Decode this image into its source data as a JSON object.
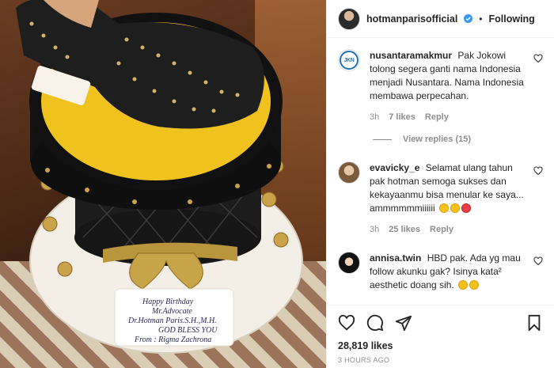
{
  "post": {
    "photo": {
      "cake_card_lines": [
        "Happy Birthday",
        "Mr.Advocate",
        "Dr.Hotman Paris.S.H.,M.H.",
        "GOD BLESS YOU",
        "From : Rigma Zachrona"
      ]
    },
    "header": {
      "username": "hotmanparisofficial",
      "separator": "•",
      "follow_label": "Following"
    },
    "comments": [
      {
        "username": "nusantaramakmur",
        "avatar_text": "JKN",
        "text": "Pak Jokowi tolong segera ganti nama Indonesia menjadi Nusantara. Nama Indonesia membawa perpecahan.",
        "time": "3h",
        "likes": "7 likes",
        "reply": "Reply"
      },
      {
        "username": "evavicky_e",
        "text": "Selamat ulang tahun pak hotman semoga sukses dan kekayaanmu bisa menular ke saya... ammmmmmiiiiii",
        "time": "3h",
        "likes": "25 likes",
        "reply": "Reply"
      },
      {
        "username": "annisa.twin",
        "text": "HBD pak. Ada yg mau follow akunku gak? Isinya kata² aesthetic doang sih."
      }
    ],
    "view_replies": "View replies (15)",
    "likes_count": "28,819 likes",
    "posted_ago": "3 HOURS AGO"
  }
}
